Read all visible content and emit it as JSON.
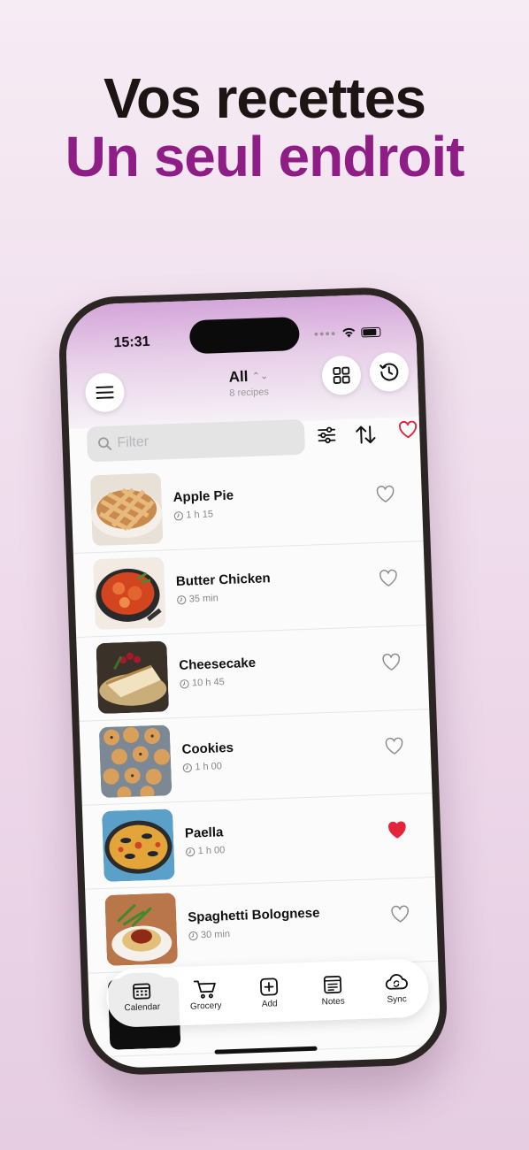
{
  "headline": {
    "line1": "Vos recettes",
    "line2": "Un seul endroit"
  },
  "status": {
    "time": "15:31"
  },
  "header": {
    "title": "All",
    "subtitle": "8 recipes"
  },
  "search": {
    "placeholder": "Filter"
  },
  "recipes": [
    {
      "name": "Apple Pie",
      "duration": "1 h 15",
      "favorite": false
    },
    {
      "name": "Butter Chicken",
      "duration": "35 min",
      "favorite": false
    },
    {
      "name": "Cheesecake",
      "duration": "10 h 45",
      "favorite": false
    },
    {
      "name": "Cookies",
      "duration": "1 h 00",
      "favorite": false
    },
    {
      "name": "Paella",
      "duration": "1 h 00",
      "favorite": true
    },
    {
      "name": "Spaghetti Bolognese",
      "duration": "30 min",
      "favorite": false
    }
  ],
  "tabs": [
    {
      "label": "Calendar",
      "icon": "calendar-icon",
      "active": true
    },
    {
      "label": "Grocery",
      "icon": "cart-icon",
      "active": false
    },
    {
      "label": "Add",
      "icon": "plus-square-icon",
      "active": false
    },
    {
      "label": "Notes",
      "icon": "notes-icon",
      "active": false
    },
    {
      "label": "Sync",
      "icon": "cloud-sync-icon",
      "active": false
    }
  ],
  "colors": {
    "accent": "#8f1d86",
    "heart": "#e5243b",
    "background": "#f1e2ef"
  }
}
